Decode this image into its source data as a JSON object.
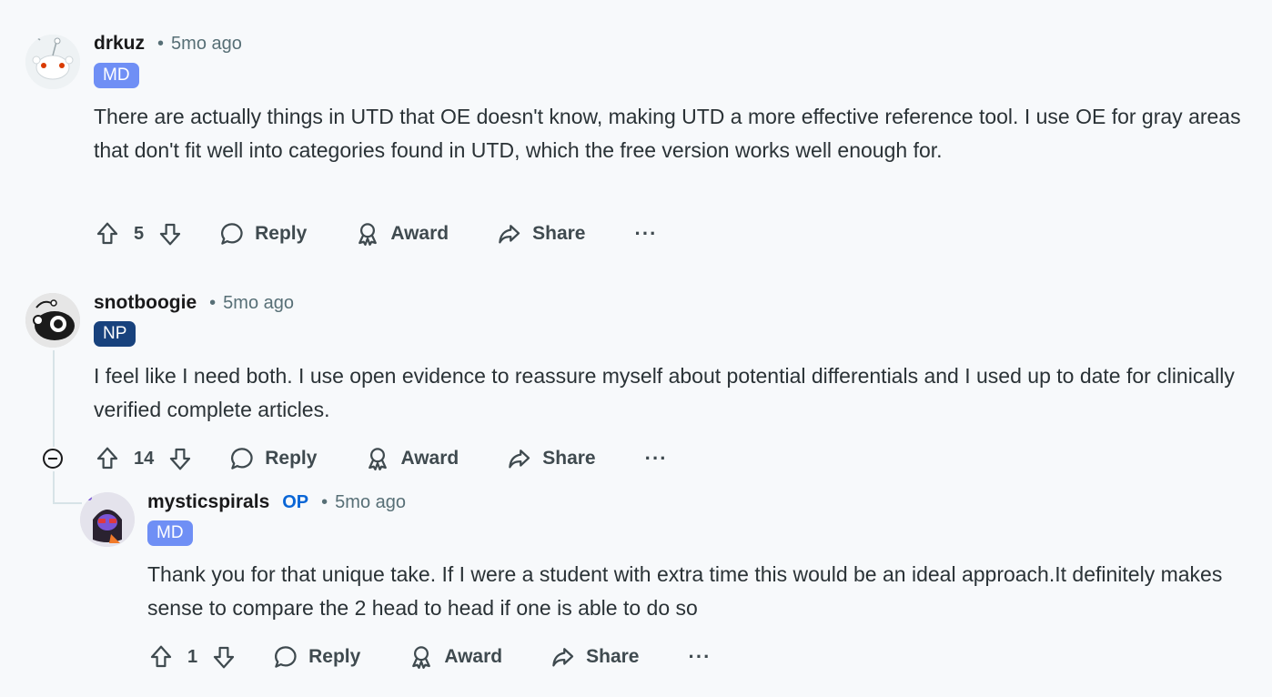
{
  "comments": [
    {
      "username": "drkuz",
      "time": "5mo ago",
      "flair": "MD",
      "body": "There are actually things in UTD that OE doesn't know, making UTD a more effective reference tool. I use OE for gray areas that don't fit well into categories found in UTD, which the free version works well enough for.",
      "votes": "5",
      "reply_label": "Reply",
      "award_label": "Award",
      "share_label": "Share",
      "more_label": "···"
    },
    {
      "username": "snotboogie",
      "time": "5mo ago",
      "flair": "NP",
      "body": "I feel like I need both. I use open evidence to reassure myself about potential differentials and I used up to date for clinically verified complete articles.",
      "votes": "14",
      "reply_label": "Reply",
      "award_label": "Award",
      "share_label": "Share",
      "more_label": "···"
    },
    {
      "username": "mysticspirals",
      "op_badge": "OP",
      "time": "5mo ago",
      "flair": "MD",
      "body": "Thank you for that unique take. If I were a student with extra time this would be an ideal approach.It definitely makes sense to compare the 2 head to head if one is able to do so",
      "votes": "1",
      "reply_label": "Reply",
      "award_label": "Award",
      "share_label": "Share",
      "more_label": "···"
    }
  ],
  "separator": "•",
  "colors": {
    "flair_md": "#6f8ff5",
    "flair_np": "#18427d",
    "op": "#0a66d6",
    "meta_gray": "#576f76"
  }
}
